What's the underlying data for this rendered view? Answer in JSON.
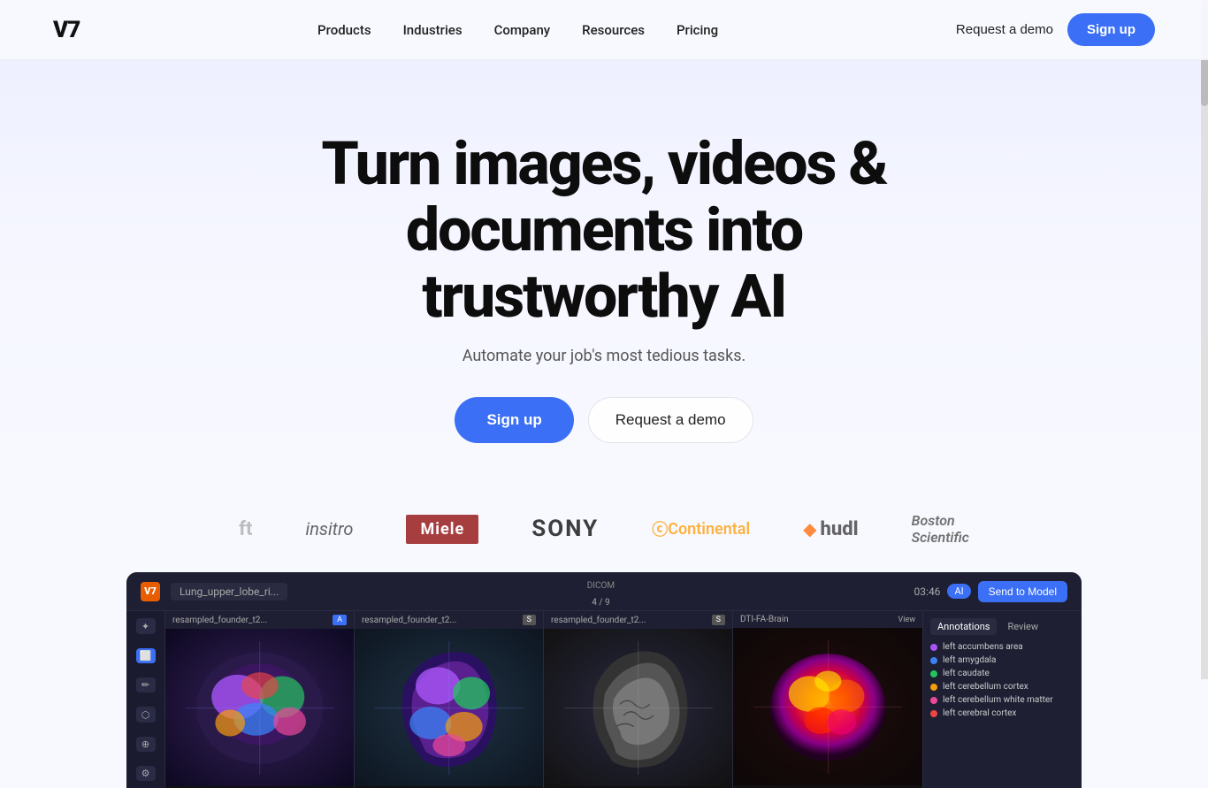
{
  "brand": {
    "logo": "V7",
    "tagline": "Turn images, videos & documents into trustworthy AI",
    "subtitle": "Automate your job's most tedious tasks."
  },
  "nav": {
    "links": [
      {
        "id": "products",
        "label": "Products"
      },
      {
        "id": "industries",
        "label": "Industries"
      },
      {
        "id": "company",
        "label": "Company"
      },
      {
        "id": "resources",
        "label": "Resources"
      },
      {
        "id": "pricing",
        "label": "Pricing"
      }
    ],
    "demo_label": "Request a demo",
    "signup_label": "Sign up"
  },
  "hero": {
    "headline_line1": "Turn images, videos &",
    "headline_line2": "documents into trustworthy AI",
    "subtitle": "Automate your job's most tedious tasks.",
    "signup_label": "Sign up",
    "demo_label": "Request a demo"
  },
  "logos": [
    {
      "id": "left-cut",
      "text": "ft",
      "style": "plain"
    },
    {
      "id": "insitro",
      "text": "insitro",
      "style": "insitro"
    },
    {
      "id": "miele",
      "text": "Miele",
      "style": "miele"
    },
    {
      "id": "sony",
      "text": "SONY",
      "style": "sony"
    },
    {
      "id": "continental",
      "text": "Continental",
      "style": "continental"
    },
    {
      "id": "hudl",
      "text": "hudl",
      "style": "hudl"
    },
    {
      "id": "boston",
      "text": "Boston Scientific",
      "style": "boston"
    }
  ],
  "app": {
    "titlebar": {
      "filename": "Lung_upper_lobe_ri...",
      "dicom_label": "DICOM",
      "pagination": "4 / 9",
      "timer": "03:46",
      "send_model_label": "Send to Model"
    },
    "panels": [
      {
        "id": "panel1",
        "label": "resampled_founder_t2...",
        "badge": "A"
      },
      {
        "id": "panel2",
        "label": "resampled_founder_t2...",
        "badge": "S"
      },
      {
        "id": "panel3",
        "label": "resampled_founder_t2...",
        "badge": "S"
      },
      {
        "id": "panel4",
        "label": "DTI-FA-Brain",
        "badge": "View"
      }
    ],
    "right_panel": {
      "tabs": [
        "Annotations",
        "Review"
      ],
      "annotations": [
        {
          "label": "left accumbens area",
          "color": "#a855f7"
        },
        {
          "label": "left amygdala",
          "color": "#3b82f6"
        },
        {
          "label": "left caudate",
          "color": "#22c55e"
        },
        {
          "label": "left cerebellum cortex",
          "color": "#f59e0b"
        },
        {
          "label": "left cerebellum white matter",
          "color": "#ec4899"
        },
        {
          "label": "left cerebral cortex",
          "color": "#ef4444"
        }
      ]
    }
  },
  "colors": {
    "accent_blue": "#3b6ff5",
    "bg_hero": "#eef0ff",
    "bg_main": "#f8f9ff"
  }
}
